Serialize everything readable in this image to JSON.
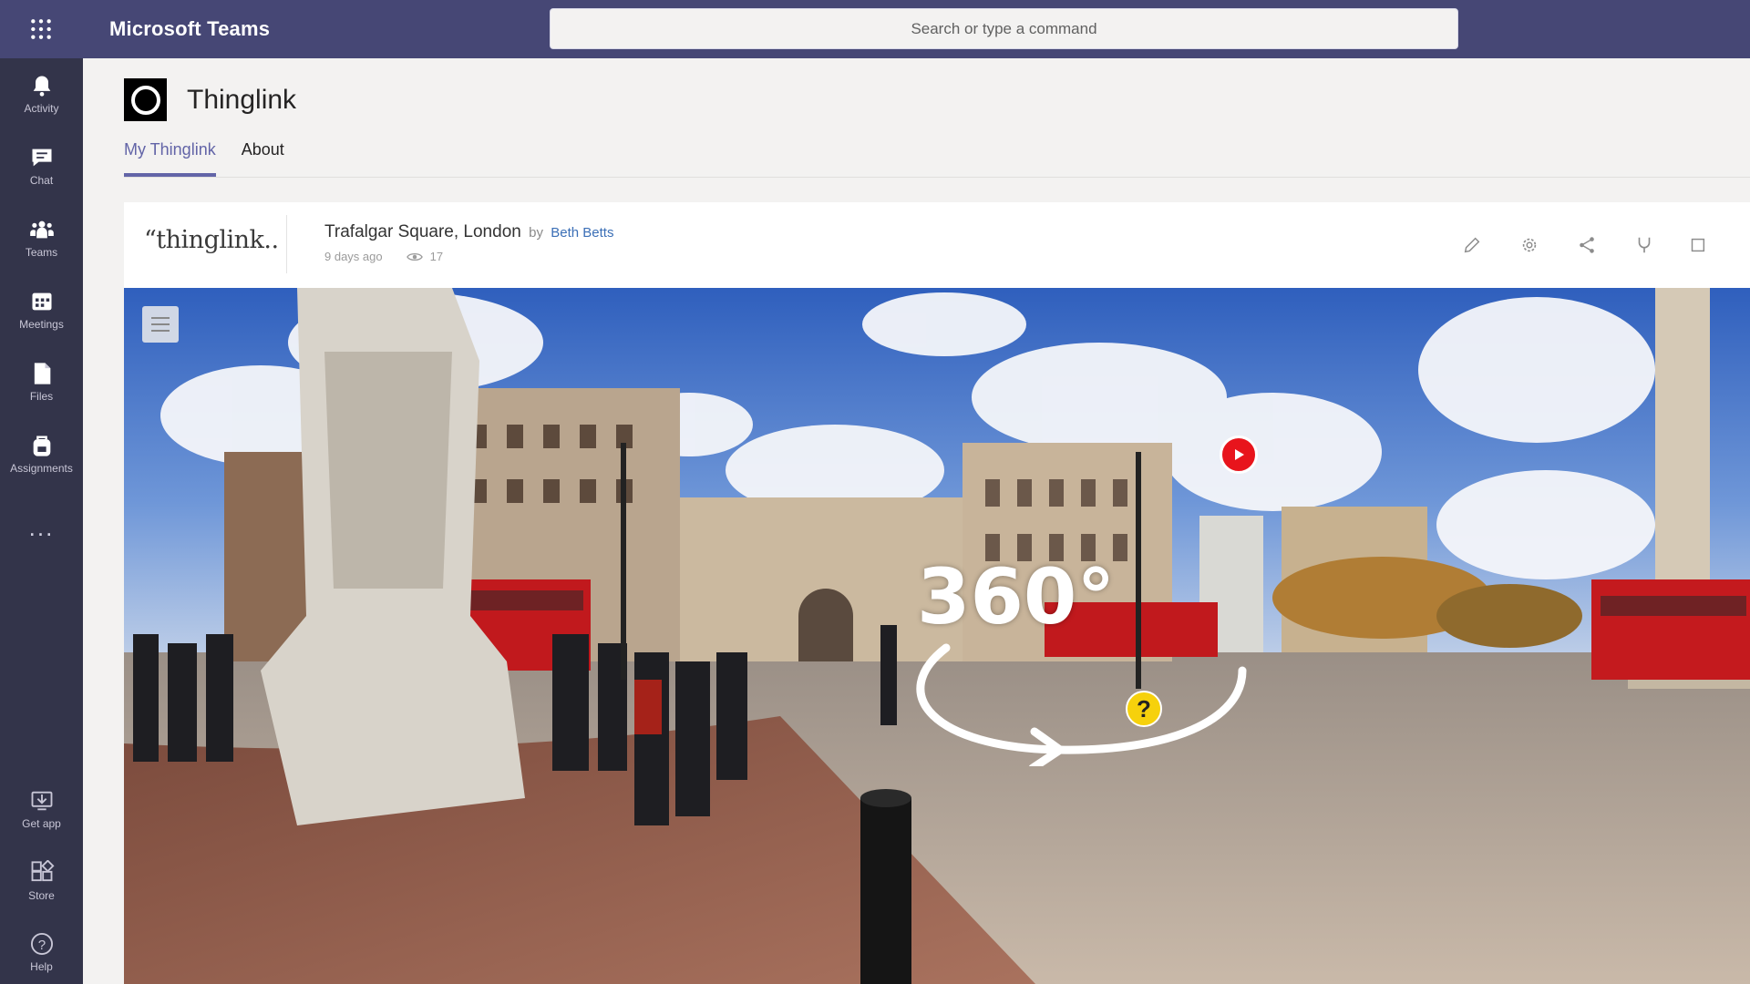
{
  "app": {
    "title": "Microsoft Teams",
    "search_placeholder": "Search or type a command"
  },
  "rail": {
    "items": [
      {
        "label": "Activity",
        "icon": "bell-icon"
      },
      {
        "label": "Chat",
        "icon": "chat-icon"
      },
      {
        "label": "Teams",
        "icon": "teams-icon"
      },
      {
        "label": "Meetings",
        "icon": "calendar-icon"
      },
      {
        "label": "Files",
        "icon": "file-icon"
      },
      {
        "label": "Assignments",
        "icon": "backpack-icon"
      }
    ],
    "more": "...",
    "bottom": [
      {
        "label": "Get app",
        "icon": "download-icon"
      },
      {
        "label": "Store",
        "icon": "store-icon"
      },
      {
        "label": "Help",
        "icon": "help-icon"
      }
    ]
  },
  "page": {
    "app_name": "Thinglink",
    "tabs": [
      {
        "label": "My Thinglink",
        "active": true
      },
      {
        "label": "About",
        "active": false
      }
    ]
  },
  "card": {
    "brand": "“thinglink..",
    "title": "Trafalgar Square, London",
    "by": "by",
    "author": "Beth Betts",
    "posted": "9 days ago",
    "views": "17",
    "tools": [
      "edit-icon",
      "settings-icon",
      "share-icon",
      "branch-icon",
      "more-icon"
    ]
  },
  "scene": {
    "label_360": "360°",
    "question_hotspot": "?"
  },
  "colors": {
    "topbar": "#464775",
    "rail": "#33344a",
    "accent": "#6264a7",
    "play_hotspot": "#e8141c",
    "question_hotspot": "#f6d10c"
  }
}
